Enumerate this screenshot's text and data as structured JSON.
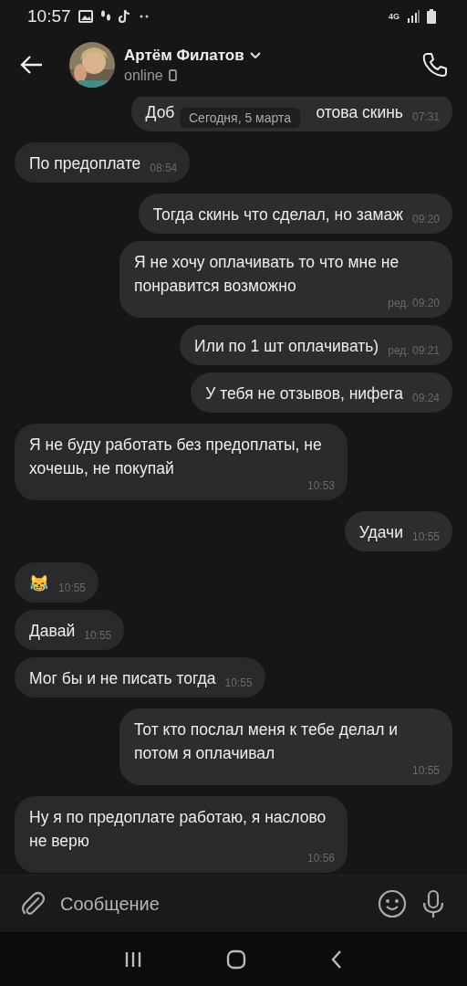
{
  "status_bar": {
    "time": "10:57",
    "network": "4G"
  },
  "header": {
    "name": "Артём Филатов",
    "status": "online"
  },
  "date_badge": "Сегодня, 5 марта",
  "messages": [
    {
      "outgoing": true,
      "parts": [
        "Доб",
        "отова скинь"
      ],
      "time": "07:31"
    },
    {
      "outgoing": false,
      "parts": [
        "По предоплате"
      ],
      "time": "08:54"
    },
    {
      "outgoing": true,
      "parts": [
        "Тогда скинь что сделал, но замаж"
      ],
      "time": "09:20"
    },
    {
      "outgoing": true,
      "parts": [
        "Я не хочу оплачивать то что мне не понравится возможно"
      ],
      "time": "ред. 09:20"
    },
    {
      "outgoing": true,
      "parts": [
        "Или по 1 шт оплачивать)"
      ],
      "time": "ред. 09:21"
    },
    {
      "outgoing": true,
      "parts": [
        "У тебя не отзывов, нифега"
      ],
      "time": "09:24"
    },
    {
      "outgoing": false,
      "parts": [
        "Я не буду работать без предоплаты, не хочешь, не покупай"
      ],
      "time": "10:53"
    },
    {
      "outgoing": true,
      "parts": [
        "Удачи"
      ],
      "time": "10:55"
    },
    {
      "outgoing": false,
      "parts": [
        "😹"
      ],
      "time": "10:55"
    },
    {
      "outgoing": false,
      "parts": [
        "Давай"
      ],
      "time": "10:55"
    },
    {
      "outgoing": false,
      "parts": [
        "Мог бы и не писать тогда"
      ],
      "time": "10:55"
    },
    {
      "outgoing": true,
      "parts": [
        "Тот кто послал меня к тебе делал и потом я оплачивал"
      ],
      "time": "10:55"
    },
    {
      "outgoing": false,
      "parts": [
        "Ну я по предоплате работаю, я наслово не верю"
      ],
      "time": "10:56"
    }
  ],
  "composer": {
    "placeholder": "Сообщение"
  }
}
